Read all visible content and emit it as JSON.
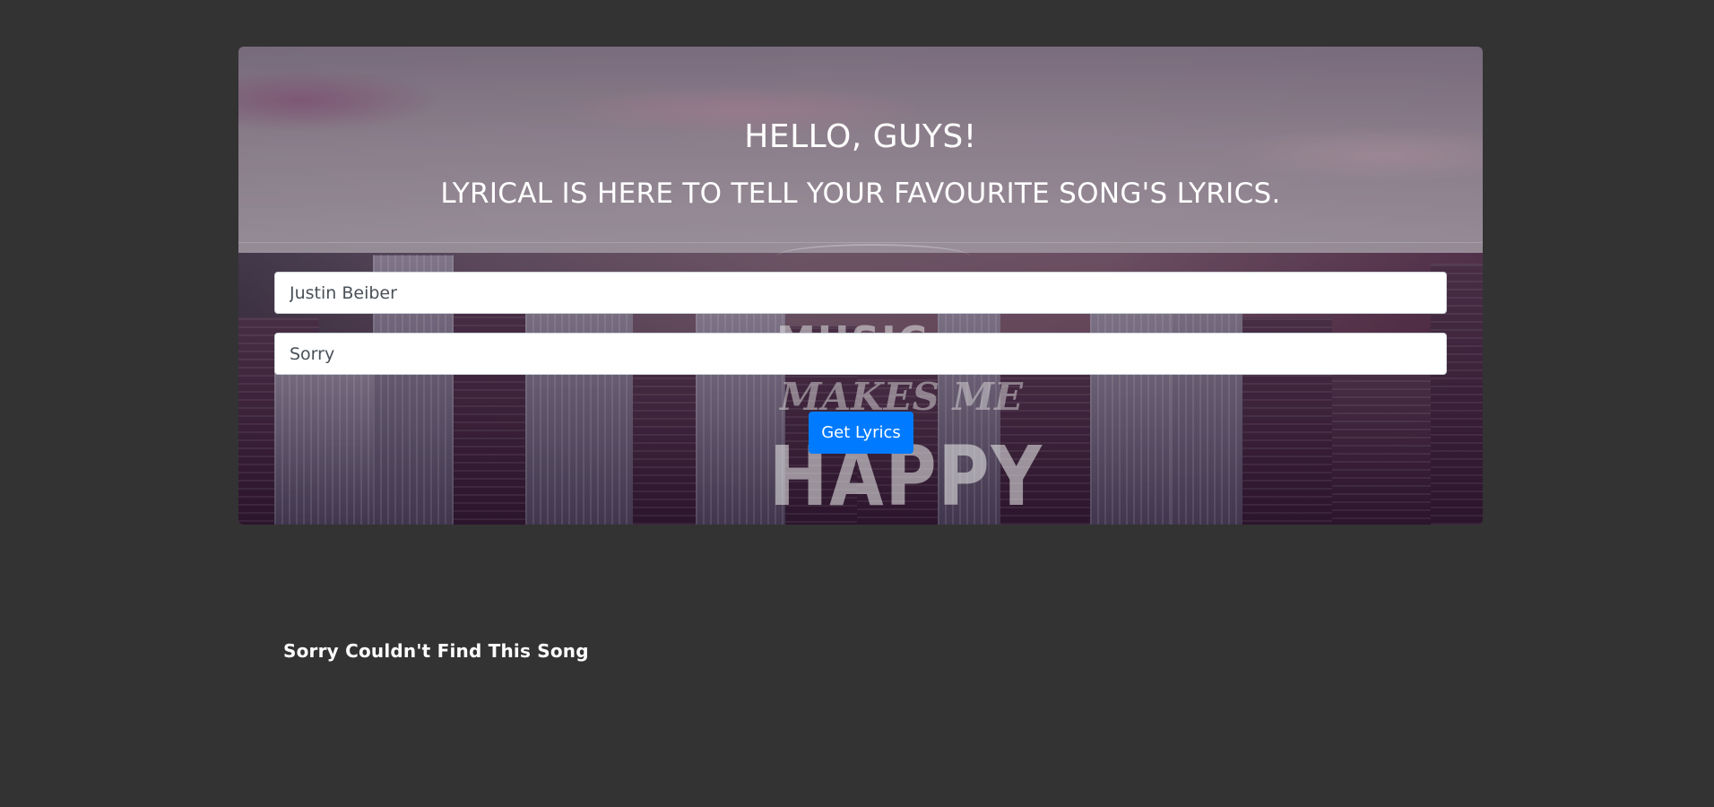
{
  "hero": {
    "title": "HELLO, GUYS!",
    "subtitle": "LYRICAL IS HERE TO TELL YOUR FAVOURITE SONG'S LYRICS.",
    "background_text": {
      "line1": "MUSIC",
      "line2": "MAKES ME",
      "line3": "HAPPY"
    }
  },
  "form": {
    "artist_value": "Justin Beiber",
    "song_value": "Sorry",
    "submit_label": "Get Lyrics"
  },
  "result": {
    "message": "Sorry Couldn't Find This Song"
  },
  "colors": {
    "page_background": "#333333",
    "button": "#007bff",
    "text": "#ffffff"
  }
}
